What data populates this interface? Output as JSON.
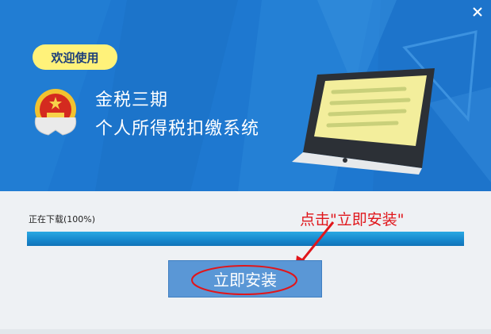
{
  "window": {
    "close_icon": "close-icon"
  },
  "banner": {
    "welcome_label": "欢迎使用",
    "title_line1": "金税三期",
    "title_line2": "个人所得税扣缴系统",
    "emblem_icon": "national-emblem-icon",
    "illustration_icon": "laptop-illustration-icon"
  },
  "download": {
    "status": "正在下载(100%)",
    "progress": 1.0
  },
  "actions": {
    "install_label": "立即安装"
  },
  "annotation": {
    "text": "点击\"立即安装\"",
    "color": "#e0161b"
  },
  "colors": {
    "banner": "#1e78d0",
    "welcome_bg": "#fff27a",
    "button": "#5a97d6",
    "progress": "#1687cc"
  }
}
